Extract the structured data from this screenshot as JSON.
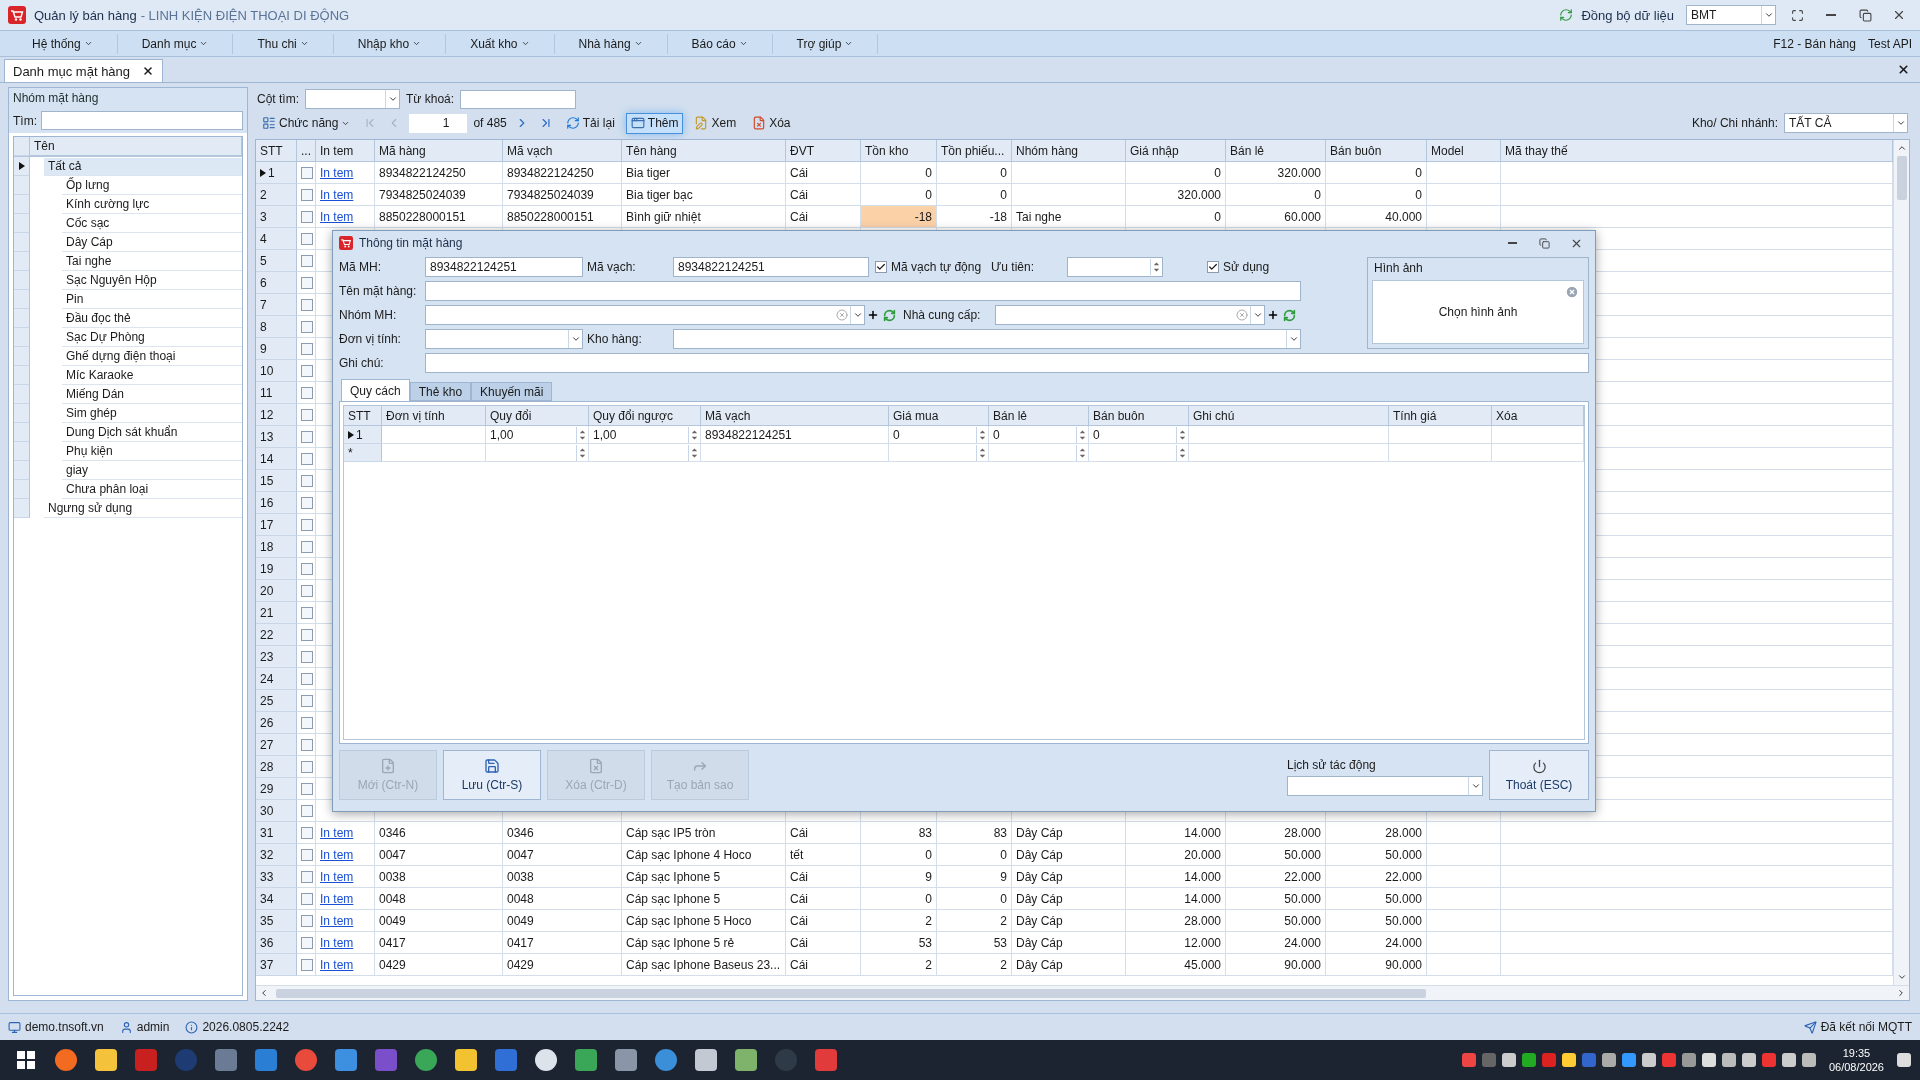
{
  "title_bar": {
    "app_name": "Quản lý bán hàng",
    "shop_name": "- LINH KIỆN ĐIỆN THOẠI DI ĐỘNG",
    "sync_label": "Đồng bộ dữ liệu",
    "branch_value": "BMT"
  },
  "menu": [
    {
      "label": "Hệ thống"
    },
    {
      "label": "Danh mục"
    },
    {
      "label": "Thu chi"
    },
    {
      "label": "Nhập kho"
    },
    {
      "label": "Xuất kho"
    },
    {
      "label": "Nhà hàng"
    },
    {
      "label": "Báo cáo"
    },
    {
      "label": "Trợ giúp"
    }
  ],
  "menu_right": [
    "F12 - Bán hàng",
    "Test API"
  ],
  "doc_tabs": [
    {
      "label": "Danh mục mặt hàng",
      "selected": true
    }
  ],
  "group_panel": {
    "title": "Nhóm mặt hàng",
    "search_label": "Tìm:",
    "column": "Tên",
    "tree": [
      {
        "label": "Tất cả",
        "selected": true,
        "children": [
          {
            "label": "Ốp lưng",
            "selected": false
          },
          {
            "label": "Kính cường lực",
            "selected": false
          },
          {
            "label": "Cốc sạc",
            "selected": false
          },
          {
            "label": "Dây Cáp",
            "selected": false
          },
          {
            "label": "Tai nghe",
            "selected": false
          },
          {
            "label": "Sạc Nguyên Hộp",
            "selected": false
          },
          {
            "label": "Pin",
            "selected": false
          },
          {
            "label": "Đầu đọc thẻ",
            "selected": false
          },
          {
            "label": "Sạc Dự Phòng",
            "selected": false
          },
          {
            "label": "Ghế dựng điện thoại",
            "selected": false
          },
          {
            "label": "Míc Karaoke",
            "selected": false
          },
          {
            "label": "Miếng Dán",
            "selected": false
          },
          {
            "label": "Sim ghép",
            "selected": false
          },
          {
            "label": "Dung Dịch sát khuẩn",
            "selected": false
          },
          {
            "label": "Phụ kiện",
            "selected": false
          },
          {
            "label": "giay",
            "selected": false
          },
          {
            "label": "Chưa phân loại",
            "selected": false
          }
        ]
      },
      {
        "label": "Ngưng sử dụng",
        "selected": false
      }
    ]
  },
  "toolbar": {
    "search_column_label": "Cột tìm:",
    "keyword_label": "Từ khoá:",
    "functions": "Chức năng",
    "page": "1",
    "page_count": "of 485",
    "buttons": [
      {
        "label": "Tải lại",
        "kind": "reload",
        "highlighted": false
      },
      {
        "label": "Thêm",
        "kind": "add",
        "highlighted": true
      },
      {
        "label": "Xem",
        "kind": "view",
        "highlighted": false
      },
      {
        "label": "Xóa",
        "kind": "delete",
        "highlighted": false
      }
    ],
    "branch_label": "Kho/ Chi nhánh:",
    "branch_value": "TẤT CẢ"
  },
  "grid": {
    "columns": [
      "STT",
      "...",
      "In tem",
      "Mã hàng",
      "Mã vạch",
      "Tên hàng",
      "ĐVT",
      "Tồn kho",
      "Tồn phiếu...",
      "Nhóm hàng",
      "Giá nhập",
      "Bán lẻ",
      "Bán buôn",
      "Model",
      "Mã thay thế"
    ],
    "rows": [
      {
        "stt": "1",
        "selected": true,
        "checked": false,
        "low_stock": false,
        "print": "In tem",
        "code": "8934822124250",
        "barcode": "8934822124250",
        "name": "Bia tiger",
        "unit": "Cái",
        "stock": "0",
        "stock_slip": "0",
        "cost": "0",
        "retail": "320.000",
        "wholesale": "0"
      },
      {
        "stt": "2",
        "selected": false,
        "checked": false,
        "low_stock": false,
        "print": "In tem",
        "code": "7934825024039",
        "barcode": "7934825024039",
        "name": "Bia tiger bạc",
        "unit": "Cái",
        "stock": "0",
        "stock_slip": "0",
        "cost": "320.000",
        "retail": "0",
        "wholesale": "0"
      },
      {
        "stt": "3",
        "selected": false,
        "checked": false,
        "low_stock": true,
        "print": "In tem",
        "code": "8850228000151",
        "barcode": "8850228000151",
        "name": "Bình giữ nhiệt",
        "unit": "Cái",
        "stock": "-18",
        "stock_slip": "-18",
        "group": "Tai nghe",
        "cost": "0",
        "retail": "60.000",
        "wholesale": "40.000"
      },
      {
        "stt": "4",
        "selected": false,
        "checked": false
      },
      {
        "stt": "5",
        "selected": false,
        "checked": false
      },
      {
        "stt": "6",
        "selected": false,
        "checked": false
      },
      {
        "stt": "7",
        "selected": false,
        "checked": false
      },
      {
        "stt": "8",
        "selected": false,
        "checked": false
      },
      {
        "stt": "9",
        "selected": false,
        "checked": false
      },
      {
        "stt": "10",
        "selected": false,
        "checked": false
      },
      {
        "stt": "11",
        "selected": false,
        "checked": false
      },
      {
        "stt": "12",
        "selected": false,
        "checked": false
      },
      {
        "stt": "13",
        "selected": false,
        "checked": false
      },
      {
        "stt": "14",
        "selected": false,
        "checked": false
      },
      {
        "stt": "15",
        "selected": false,
        "checked": false
      },
      {
        "stt": "16",
        "selected": false,
        "checked": false
      },
      {
        "stt": "17",
        "selected": false,
        "checked": false
      },
      {
        "stt": "18",
        "selected": false,
        "checked": false
      },
      {
        "stt": "19",
        "selected": false,
        "checked": false
      },
      {
        "stt": "20",
        "selected": false,
        "checked": false
      },
      {
        "stt": "21",
        "selected": false,
        "checked": false
      },
      {
        "stt": "22",
        "selected": false,
        "checked": false
      },
      {
        "stt": "23",
        "selected": false,
        "checked": false
      },
      {
        "stt": "24",
        "selected": false,
        "checked": false
      },
      {
        "stt": "25",
        "selected": false,
        "checked": false
      },
      {
        "stt": "26",
        "selected": false,
        "checked": false
      },
      {
        "stt": "27",
        "selected": false,
        "checked": false
      },
      {
        "stt": "28",
        "selected": false,
        "checked": false
      },
      {
        "stt": "29",
        "selected": false,
        "checked": false
      },
      {
        "stt": "30",
        "selected": false,
        "checked": false
      },
      {
        "stt": "31",
        "selected": false,
        "checked": false,
        "low_stock": false,
        "print": "In tem",
        "code": "0346",
        "barcode": "0346",
        "name": "Cáp sạc IP5 tròn",
        "unit": "Cái",
        "stock": "83",
        "stock_slip": "83",
        "group": "Dây Cáp",
        "cost": "14.000",
        "retail": "28.000",
        "wholesale": "28.000"
      },
      {
        "stt": "32",
        "selected": false,
        "checked": false,
        "low_stock": false,
        "print": "In tem",
        "code": "0047",
        "barcode": "0047",
        "name": "Cáp sạc Iphone 4 Hoco",
        "unit": "tết",
        "stock": "0",
        "stock_slip": "0",
        "group": "Dây Cáp",
        "cost": "20.000",
        "retail": "50.000",
        "wholesale": "50.000"
      },
      {
        "stt": "33",
        "selected": false,
        "checked": false,
        "low_stock": false,
        "print": "In tem",
        "code": "0038",
        "barcode": "0038",
        "name": "Cáp sạc Iphone 5",
        "unit": "Cái",
        "stock": "9",
        "stock_slip": "9",
        "group": "Dây Cáp",
        "cost": "14.000",
        "retail": "22.000",
        "wholesale": "22.000"
      },
      {
        "stt": "34",
        "selected": false,
        "checked": false,
        "low_stock": false,
        "print": "In tem",
        "code": "0048",
        "barcode": "0048",
        "name": "Cáp sạc Iphone 5",
        "unit": "Cái",
        "stock": "0",
        "stock_slip": "0",
        "group": "Dây Cáp",
        "cost": "14.000",
        "retail": "50.000",
        "wholesale": "50.000"
      },
      {
        "stt": "35",
        "selected": false,
        "checked": false,
        "low_stock": false,
        "print": "In tem",
        "code": "0049",
        "barcode": "0049",
        "name": "Cáp sạc Iphone 5 Hoco",
        "unit": "Cái",
        "stock": "2",
        "stock_slip": "2",
        "group": "Dây Cáp",
        "cost": "28.000",
        "retail": "50.000",
        "wholesale": "50.000"
      },
      {
        "stt": "36",
        "selected": false,
        "checked": false,
        "low_stock": false,
        "print": "In tem",
        "code": "0417",
        "barcode": "0417",
        "name": "Cáp sạc Iphone 5 rẻ",
        "unit": "Cái",
        "stock": "53",
        "stock_slip": "53",
        "group": "Dây Cáp",
        "cost": "12.000",
        "retail": "24.000",
        "wholesale": "24.000"
      },
      {
        "stt": "37",
        "selected": false,
        "checked": false,
        "low_stock": false,
        "print": "In tem",
        "code": "0429",
        "barcode": "0429",
        "name": "Cáp sạc Iphone Baseus 23...",
        "unit": "Cái",
        "stock": "2",
        "stock_slip": "2",
        "group": "Dây Cáp",
        "cost": "45.000",
        "retail": "90.000",
        "wholesale": "90.000"
      }
    ]
  },
  "dialog": {
    "title": "Thông tin mặt hàng",
    "fields": {
      "code_label": "Mã MH:",
      "code": "8934822124251",
      "barcode_label": "Mã vạch:",
      "barcode": "8934822124251",
      "priority_label": "Ưu tiên:",
      "name_label": "Tên mặt hàng:",
      "group_label": "Nhóm MH:",
      "supplier_label": "Nhà cung cấp:",
      "unit_label": "Đơn vị tính:",
      "warehouse_label": "Kho hàng:",
      "note_label": "Ghi chú:"
    },
    "checkboxes": [
      {
        "label": "Mã vạch tự động",
        "checked": true
      },
      {
        "label": "Sử dụng",
        "checked": true
      }
    ],
    "image": {
      "title": "Hình ảnh",
      "action": "Chọn hình ảnh"
    },
    "tabs": [
      {
        "label": "Quy cách",
        "selected": true
      },
      {
        "label": "Thẻ kho",
        "selected": false
      },
      {
        "label": "Khuyến mãi",
        "selected": false
      }
    ],
    "columns": [
      "STT",
      "Đơn vị tính",
      "Quy đổi",
      "Quy đổi ngược",
      "Mã vạch",
      "Giá mua",
      "Bán lẻ",
      "Bán buôn",
      "Ghi chú",
      "Tính giá",
      "Xóa"
    ],
    "rows": [
      {
        "stt": "1",
        "selected": true,
        "ratio": "1,00",
        "ratio_inverse": "1,00",
        "barcode": "8934822124251",
        "cost": "0",
        "retail": "0",
        "wholesale": "0"
      },
      {
        "stt": "*",
        "selected": false
      }
    ],
    "buttons": [
      {
        "label": "Mới (Ctr-N)",
        "kind": "new",
        "disabled": true
      },
      {
        "label": "Lưu (Ctr-S)",
        "kind": "save",
        "disabled": false
      },
      {
        "label": "Xóa (Ctr-D)",
        "kind": "delete",
        "disabled": true
      },
      {
        "label": "Tạo bản sao",
        "kind": "copy",
        "disabled": true
      }
    ],
    "history_label": "Lịch sử tác động",
    "exit": "Thoát (ESC)"
  },
  "status_bar": {
    "server": "demo.tnsoft.vn",
    "user": "admin",
    "version": "2026.0805.2242",
    "connection": "Đã kết nối MQTT"
  },
  "taskbar": {
    "time": "19:35",
    "date": "06/08/2026"
  }
}
